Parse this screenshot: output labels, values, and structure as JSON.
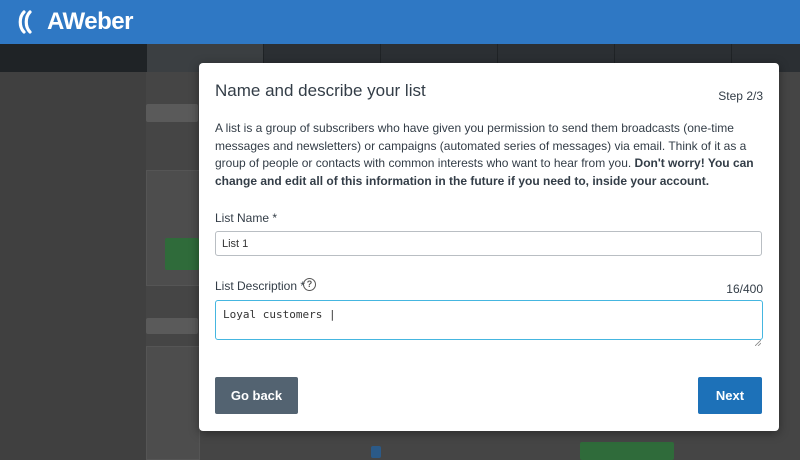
{
  "header": {
    "logo_text": "AWeber",
    "brand_color": "#2f78c4"
  },
  "modal": {
    "title": "Name and describe your list",
    "step": "Step 2/3",
    "description_plain": "A list is a group of subscribers who have given you permission to send them broadcasts (one-time messages and newsletters) or campaigns (automated series of messages) via email. Think of it as a group of people or contacts with common interests who want to hear from you. ",
    "description_bold": "Don't worry! You can change and edit all of this information in the future if you need to, inside your account.",
    "list_name": {
      "label": "List Name *",
      "value": "List 1"
    },
    "list_description": {
      "label": "List Description *",
      "help_icon": "question-circle-icon",
      "counter": "16/400",
      "value": "Loyal customers |"
    },
    "buttons": {
      "back": "Go back",
      "next": "Next"
    },
    "colors": {
      "back_button": "#536371",
      "next_button": "#1d71b8",
      "focus_border": "#45b6e0"
    }
  }
}
